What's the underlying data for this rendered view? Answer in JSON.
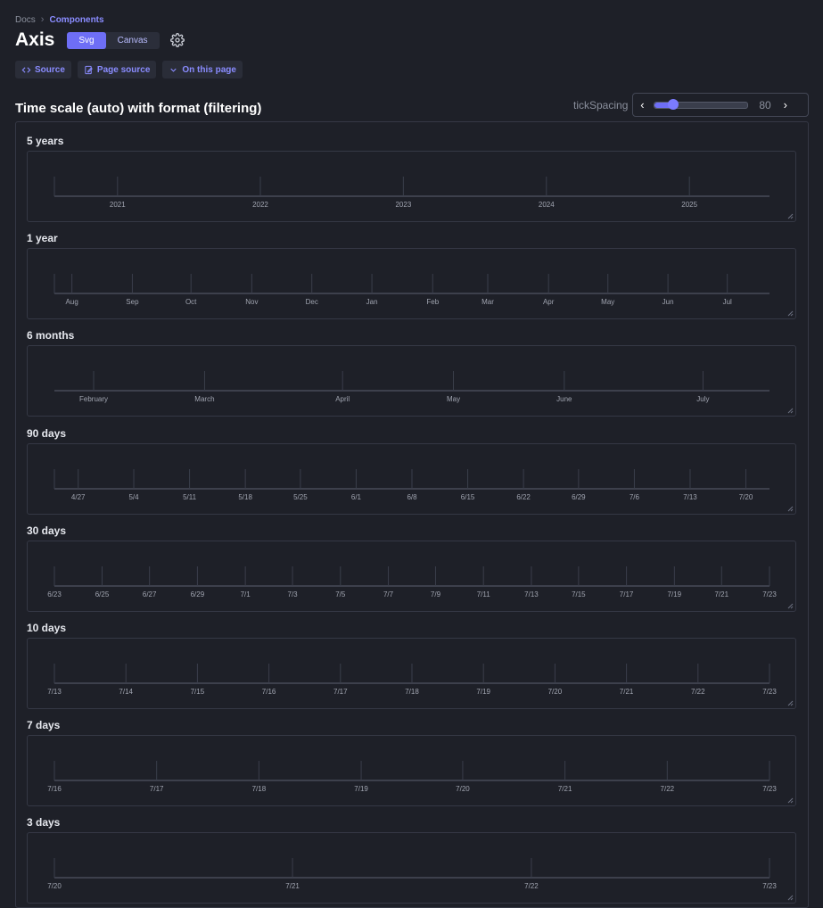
{
  "breadcrumb": {
    "docs": "Docs",
    "components": "Components"
  },
  "page": {
    "title": "Axis"
  },
  "toggle": {
    "svg": "Svg",
    "canvas": "Canvas",
    "active": "Svg"
  },
  "links": {
    "source": "Source",
    "page_source": "Page source",
    "on_this_page": "On this page"
  },
  "section": {
    "title": "Time scale (auto) with format (filtering)"
  },
  "tick_spacing": {
    "label": "tickSpacing",
    "value": 80,
    "min": 0,
    "max": 400
  },
  "icons": [
    "chevron-right-icon",
    "gear-icon",
    "code-icon",
    "file-edit-icon",
    "chevron-down-icon",
    "chevron-left-icon"
  ],
  "colors": {
    "accent": "#6e6ef5",
    "background": "#1e2028",
    "border": "#353845",
    "axis": "#5c6070",
    "tick_text": "#a0a4b0"
  },
  "chart_data": [
    {
      "type": "axis",
      "title": "5 years",
      "x": [
        "2021",
        "2022",
        "2023",
        "2024",
        "2025"
      ],
      "ticks": [
        0.0883,
        0.288,
        0.488,
        0.688,
        0.888
      ],
      "rule_start": true
    },
    {
      "type": "axis",
      "title": "1 year",
      "x": [
        "Aug",
        "Sep",
        "Oct",
        "Nov",
        "Dec",
        "Jan",
        "Feb",
        "Mar",
        "Apr",
        "May",
        "Jun",
        "Jul"
      ],
      "ticks": [
        0.0245,
        0.109,
        0.191,
        0.276,
        0.36,
        0.444,
        0.529,
        0.606,
        0.691,
        0.774,
        0.858,
        0.941
      ],
      "rule_start": true
    },
    {
      "type": "axis",
      "title": "6 months",
      "x": [
        "February",
        "March",
        "April",
        "May",
        "June",
        "July"
      ],
      "ticks": [
        0.0549,
        0.21,
        0.403,
        0.558,
        0.713,
        0.907
      ],
      "rule_start": false
    },
    {
      "type": "axis",
      "title": "90 days",
      "x": [
        "4/27",
        "5/4",
        "5/11",
        "5/18",
        "5/25",
        "6/1",
        "6/8",
        "6/15",
        "6/22",
        "6/29",
        "7/6",
        "7/13",
        "7/20"
      ],
      "ticks": [
        0.0333,
        0.111,
        0.189,
        0.267,
        0.344,
        0.422,
        0.5,
        0.578,
        0.656,
        0.733,
        0.811,
        0.889,
        0.967
      ],
      "rule_start": true
    },
    {
      "type": "axis",
      "title": "30 days",
      "x": [
        "6/23",
        "6/25",
        "6/27",
        "6/29",
        "7/1",
        "7/3",
        "7/5",
        "7/7",
        "7/9",
        "7/11",
        "7/13",
        "7/15",
        "7/17",
        "7/19",
        "7/21",
        "7/23"
      ],
      "ticks": [
        0,
        0.0667,
        0.133,
        0.2,
        0.267,
        0.333,
        0.4,
        0.467,
        0.533,
        0.6,
        0.667,
        0.733,
        0.8,
        0.867,
        0.933,
        1
      ],
      "rule_start": false
    },
    {
      "type": "axis",
      "title": "10 days",
      "x": [
        "7/13",
        "7/14",
        "7/15",
        "7/16",
        "7/17",
        "7/18",
        "7/19",
        "7/20",
        "7/21",
        "7/22",
        "7/23"
      ],
      "ticks": [
        0,
        0.1,
        0.2,
        0.3,
        0.4,
        0.5,
        0.6,
        0.7,
        0.8,
        0.9,
        1
      ],
      "rule_start": false
    },
    {
      "type": "axis",
      "title": "7 days",
      "x": [
        "7/16",
        "7/17",
        "7/18",
        "7/19",
        "7/20",
        "7/21",
        "7/22",
        "7/23"
      ],
      "ticks": [
        0,
        0.143,
        0.286,
        0.429,
        0.571,
        0.714,
        0.857,
        1
      ],
      "rule_start": false
    },
    {
      "type": "axis",
      "title": "3 days",
      "x": [
        "7/20",
        "7/21",
        "7/22",
        "7/23"
      ],
      "ticks": [
        0,
        0.333,
        0.667,
        1
      ],
      "rule_start": false
    }
  ]
}
